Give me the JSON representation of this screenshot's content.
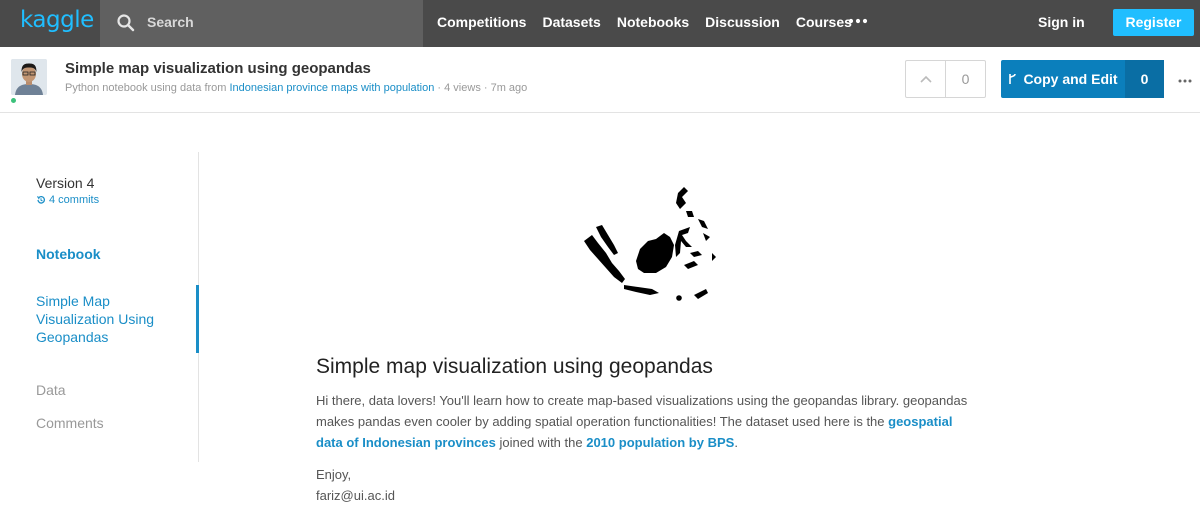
{
  "topnav": {
    "logo": "kaggle",
    "search_label": "Search",
    "links": [
      "Competitions",
      "Datasets",
      "Notebooks",
      "Discussion",
      "Courses"
    ],
    "signin": "Sign in",
    "register": "Register"
  },
  "kernel": {
    "title": "Simple map visualization using geopandas",
    "subtitle_prefix": "Python notebook using data from ",
    "dataset_link": "Indonesian province maps with population",
    "subtitle_suffix": " · 4 views · 7m ago",
    "vote_count": "0",
    "copy_edit_label": "Copy and Edit",
    "copy_edit_count": "0"
  },
  "sidebar": {
    "version": "Version 4",
    "commits": "4 commits",
    "notebook": "Notebook",
    "active_item": "Simple Map Visualization Using Geopandas",
    "data": "Data",
    "comments": "Comments"
  },
  "content": {
    "heading": "Simple map visualization using geopandas",
    "para_1": "Hi there, data lovers! You'll learn how to create map-based visualizations using the geopandas library. geopandas makes pandas even cooler by adding spatial operation functionalities! The dataset used here is the ",
    "link_1": "geospatial data of Indonesian provinces",
    "para_2": " joined with the ",
    "link_2": "2010 population by BPS",
    "para_3": ".",
    "enjoy": "Enjoy,",
    "email": "fariz@ui.ac.id"
  },
  "colors": {
    "nav_bg": "#4a4a4a",
    "accent": "#20beff",
    "link": "#1a8ec7",
    "button": "#0b7fbc"
  }
}
